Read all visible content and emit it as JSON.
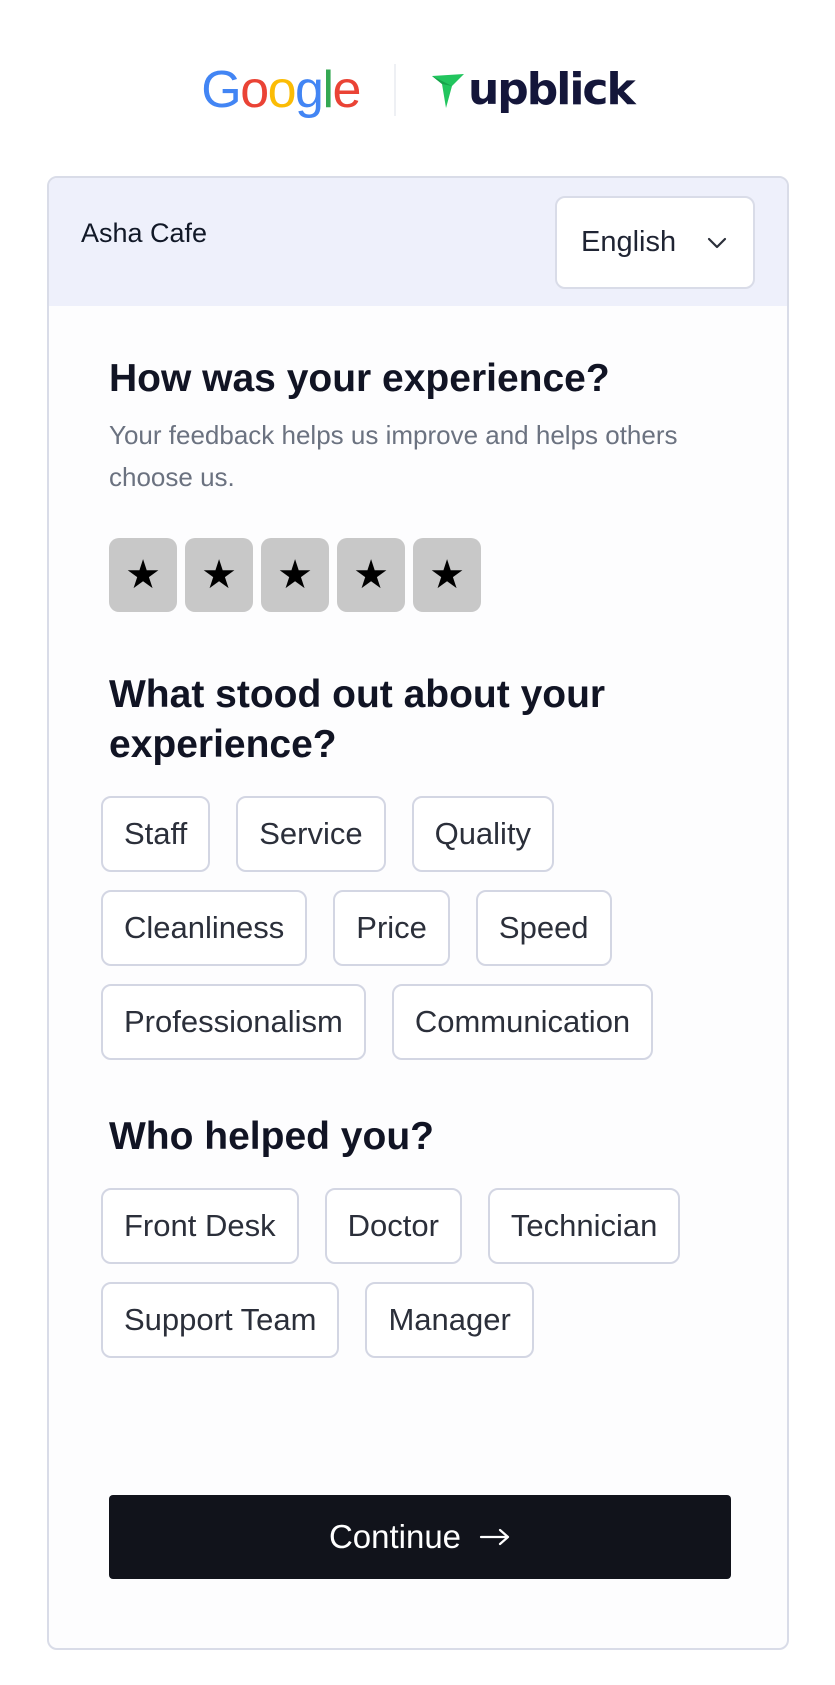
{
  "header": {
    "google_logo_text": "Google",
    "upblick_logo_text": "upblick"
  },
  "card": {
    "business_name": "Asha Cafe",
    "language_selected": "English"
  },
  "rating": {
    "title": "How was your experience?",
    "subtitle": "Your feedback helps us improve and helps others choose us.",
    "stars": [
      "★",
      "★",
      "★",
      "★",
      "★"
    ],
    "max_stars": 5
  },
  "standout": {
    "title": "What stood out about your experience?",
    "options": [
      "Staff",
      "Service",
      "Quality",
      "Cleanliness",
      "Price",
      "Speed",
      "Professionalism",
      "Communication"
    ]
  },
  "helpers": {
    "title": "Who helped you?",
    "options": [
      "Front Desk",
      "Doctor",
      "Technician",
      "Support Team",
      "Manager"
    ]
  },
  "actions": {
    "continue_label": "Continue"
  },
  "colors": {
    "google_blue": "#4285F4",
    "google_red": "#EA4335",
    "google_yellow": "#FBBC05",
    "google_green": "#34A853",
    "upblick_green": "#22c55e",
    "upblick_navy": "#14163a",
    "card_header_bg": "#eef0fb",
    "button_bg": "#11131b",
    "star_bg": "#c8c8c8"
  },
  "icons": {
    "language_chevron": "chevron-down-icon",
    "continue_arrow": "arrow-right-icon",
    "upblick_mark": "upblick-flag-icon"
  }
}
